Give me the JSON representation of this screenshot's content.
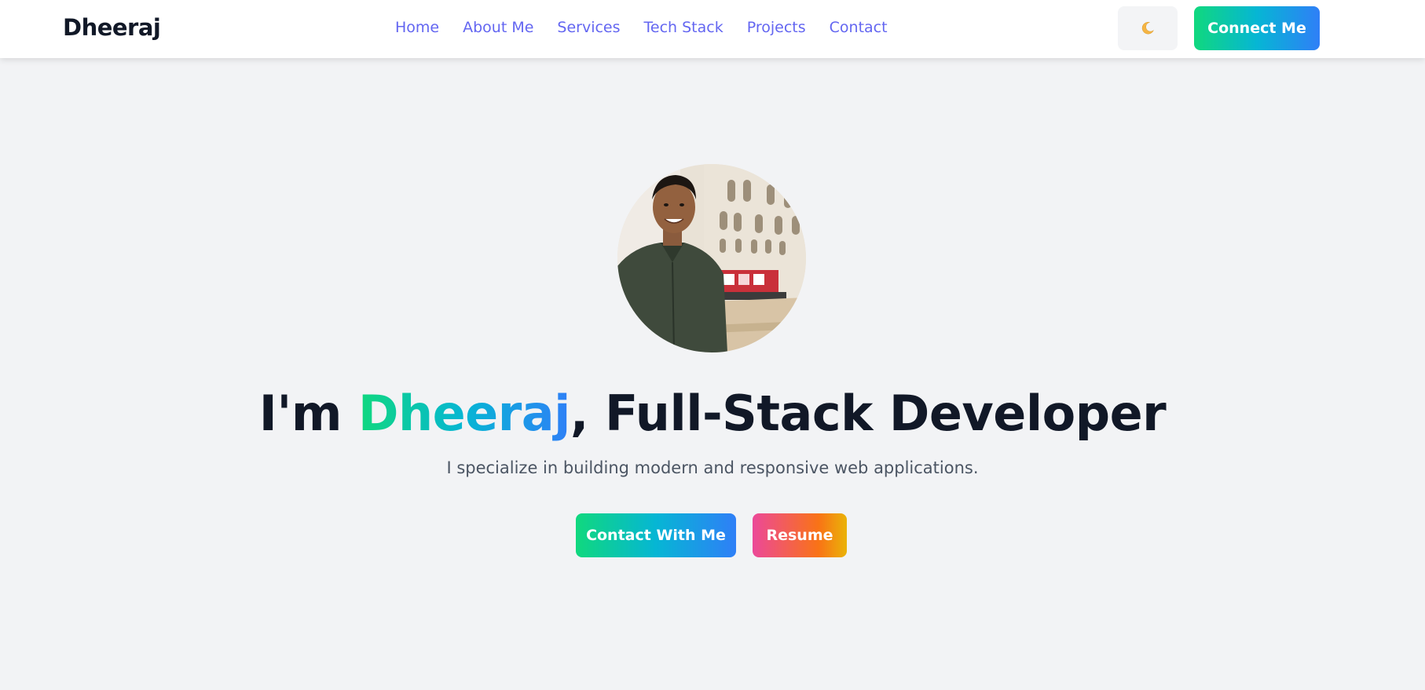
{
  "header": {
    "brand": "Dheeraj",
    "nav": [
      {
        "label": "Home"
      },
      {
        "label": "About Me"
      },
      {
        "label": "Services"
      },
      {
        "label": "Tech Stack"
      },
      {
        "label": "Projects"
      },
      {
        "label": "Contact"
      }
    ],
    "theme_toggle_icon": "moon-icon",
    "connect_label": "Connect Me"
  },
  "hero": {
    "avatar_alt": "Profile photo",
    "title_prefix": "I'm ",
    "title_name": "Dheeraj",
    "title_suffix": ", Full-Stack Developer",
    "subtitle": "I specialize in building modern and responsive web applications.",
    "contact_button": "Contact With Me",
    "resume_button": "Resume"
  },
  "colors": {
    "accent_gradient_start": "#10d87e",
    "accent_gradient_end": "#2f7ff7",
    "nav_link": "#6366f1",
    "resume_gradient_start": "#ec4899",
    "resume_gradient_end": "#eab308",
    "page_background": "#f2f3f5"
  }
}
